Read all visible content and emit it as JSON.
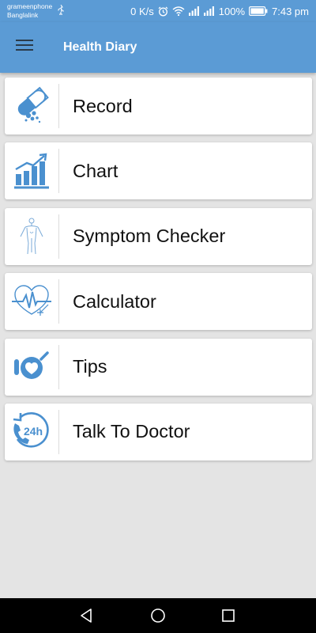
{
  "status_bar": {
    "carrier_primary": "grameenphone",
    "carrier_secondary": "Banglalink",
    "net_speed": "0 K/s",
    "battery": "100%",
    "time": "7:43 pm"
  },
  "app_bar": {
    "title": "Health Diary",
    "menu_icon": "hamburger-menu-icon"
  },
  "menu_items": [
    {
      "label": "Record",
      "icon": "pills-icon"
    },
    {
      "label": "Chart",
      "icon": "bar-chart-icon"
    },
    {
      "label": "Symptom Checker",
      "icon": "body-figure-icon"
    },
    {
      "label": "Calculator",
      "icon": "heart-pulse-icon"
    },
    {
      "label": "Tips",
      "icon": "heart-tips-icon"
    },
    {
      "label": "Talk To Doctor",
      "icon": "phone-24h-icon"
    }
  ],
  "nav_bar": {
    "back_icon": "back-triangle-icon",
    "home_icon": "home-circle-icon",
    "recents_icon": "recents-square-icon"
  },
  "colors": {
    "primary": "#5b9bd5",
    "icon_blue": "#4a90cf",
    "background": "#e4e4e4",
    "card": "#ffffff",
    "nav_bar": "#000000"
  }
}
